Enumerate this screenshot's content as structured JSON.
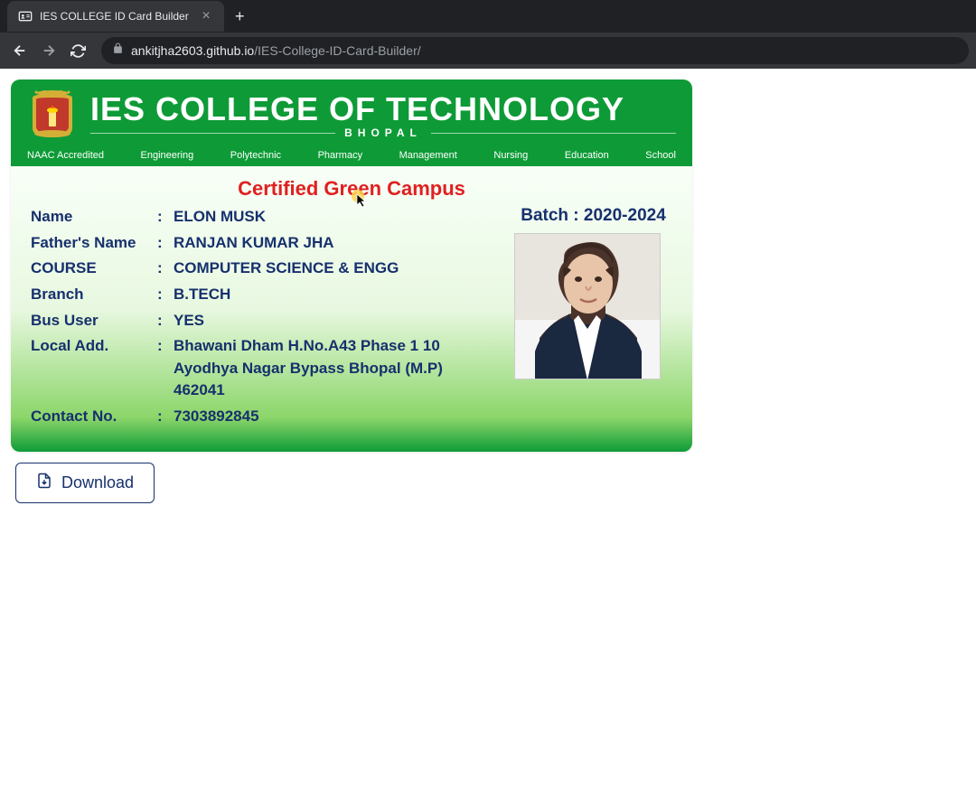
{
  "browser": {
    "tab_title": "IES COLLEGE ID Card Builder",
    "url_host": "ankitjha2603.github.io",
    "url_path": "/IES-College-ID-Card-Builder/"
  },
  "card_header": {
    "college_name": "IES COLLEGE OF TECHNOLOGY",
    "city": "BHOPAL",
    "departments": [
      "NAAC Accredited",
      "Engineering",
      "Polytechnic",
      "Pharmacy",
      "Management",
      "Nursing",
      "Education",
      "School"
    ]
  },
  "card_body": {
    "certified": "Certified Green Campus",
    "batch_label": "Batch : ",
    "batch_value": "2020-2024",
    "fields": [
      {
        "label": "Name",
        "value": "ELON MUSK"
      },
      {
        "label": "Father's Name",
        "value": "RANJAN KUMAR JHA"
      },
      {
        "label": "COURSE",
        "value": "COMPUTER SCIENCE & ENGG"
      },
      {
        "label": "Branch",
        "value": "B.TECH"
      },
      {
        "label": "Bus User",
        "value": "YES"
      },
      {
        "label": "Local Add.",
        "value": "Bhawani Dham H.No.A43 Phase 1 10 Ayodhya Nagar Bypass Bhopal (M.P) 462041"
      },
      {
        "label": "Contact No.",
        "value": "7303892845"
      }
    ]
  },
  "actions": {
    "download_label": "Download"
  }
}
